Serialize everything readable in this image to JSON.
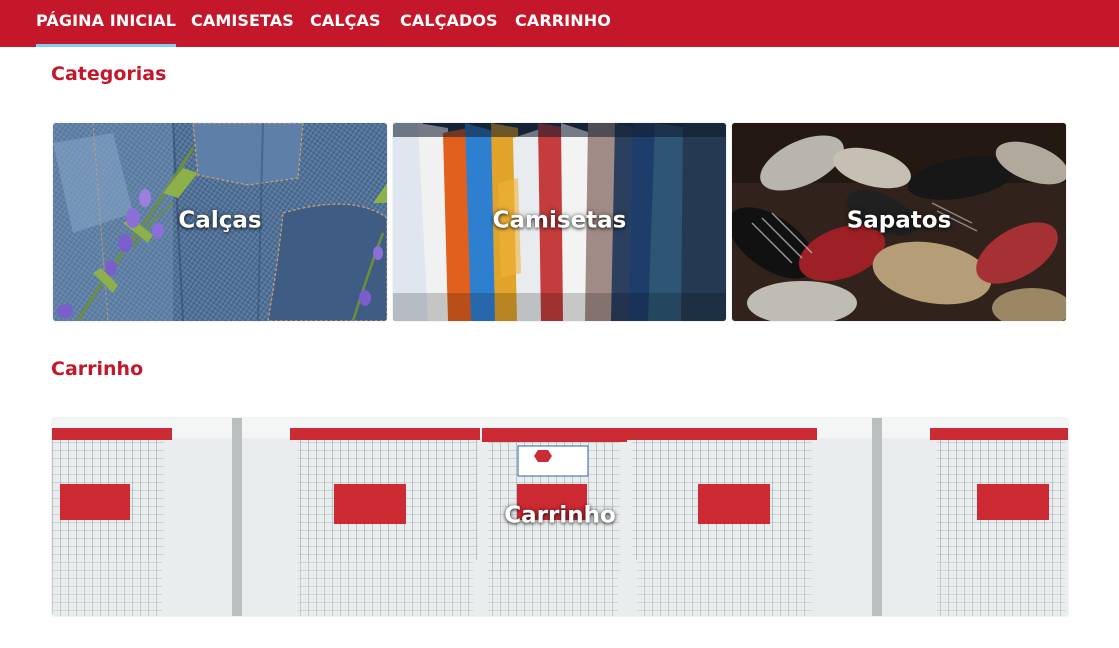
{
  "nav": {
    "items": [
      {
        "label": "PÁGINA INICIAL",
        "active": true
      },
      {
        "label": "CAMISETAS",
        "active": false
      },
      {
        "label": "CALÇAS",
        "active": false
      },
      {
        "label": "CALÇADOS",
        "active": false
      },
      {
        "label": "CARRINHO",
        "active": false
      }
    ]
  },
  "categories_section": {
    "title": "Categorias",
    "cards": [
      {
        "label": "Calças",
        "image": "denim-jeans-with-flowers"
      },
      {
        "label": "Camisetas",
        "image": "hanging-colorful-shirts"
      },
      {
        "label": "Sapatos",
        "image": "pile-of-sneakers"
      }
    ]
  },
  "cart_section": {
    "title": "Carrinho",
    "banner": {
      "label": "Carrinho",
      "image": "row-of-shopping-carts"
    }
  },
  "colors": {
    "brand_red": "#c5172a",
    "active_underline": "#7ecdf5",
    "white": "#ffffff"
  }
}
